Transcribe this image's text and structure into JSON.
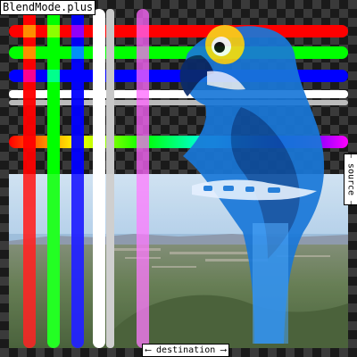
{
  "title": "BlendMode.plus",
  "source_label": "— source —",
  "destination_label": "⟵ destination ⟶",
  "colors": {
    "red": "#ff0000",
    "green": "#00ff00",
    "blue": "#0000ff",
    "white": "#ffffff",
    "parrot_blue": "#1a78d8",
    "parrot_dark": "#0b3f8a",
    "parrot_yellow": "#f7d21e"
  }
}
